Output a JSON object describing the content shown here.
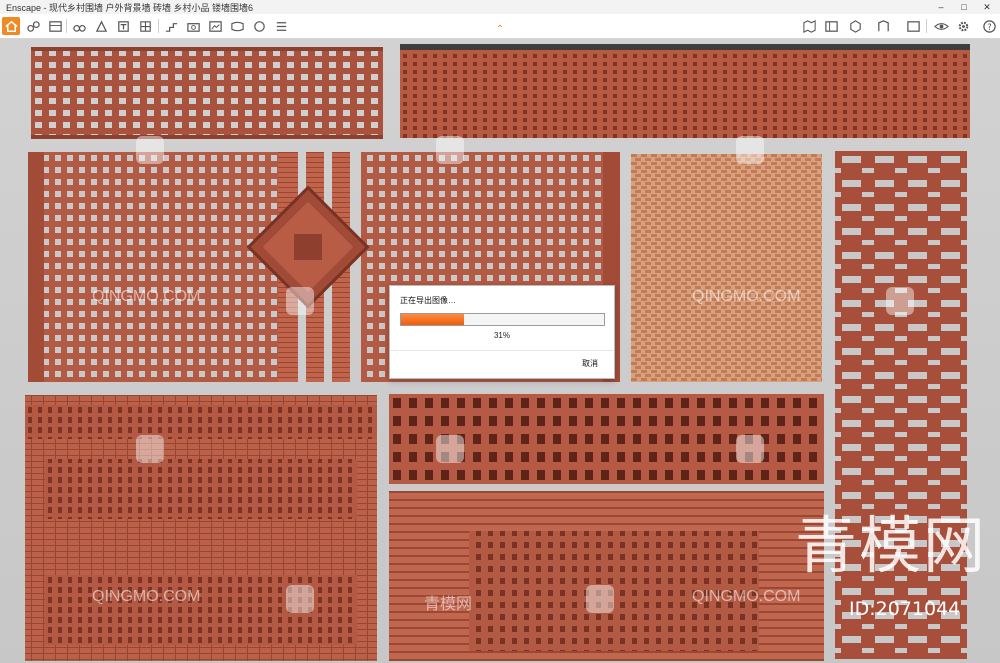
{
  "window": {
    "title": "Enscape - 现代乡村围墙 户外背景墙 砖墙 乡村小品 镂墙围墙6",
    "min_label": "–",
    "max_label": "□",
    "close_label": "✕"
  },
  "toolbar": {
    "left_icons": [
      "home-icon",
      "link-icon",
      "bim-icon",
      "binoculars-icon",
      "object-icon",
      "text-icon",
      "grid-icon",
      "stairs-icon",
      "camera-icon",
      "screenshot-icon",
      "panorama-icon",
      "render-icon",
      "batch-icon",
      "undo-icon",
      "redo-icon"
    ],
    "right_icons": [
      "map-icon",
      "layout-icon",
      "materials-icon",
      "asset-icon",
      "sky-icon",
      "visibility-icon",
      "settings-icon",
      "help-icon"
    ],
    "collapse_glyph": "⌃",
    "accent_color": "#f08a24"
  },
  "export_dialog": {
    "title": "正在导出图像…",
    "progress_percent": 31,
    "progress_label": "31%",
    "cancel_label": "取消"
  },
  "watermarks": {
    "site": "QINGMO.COM",
    "site_cn": "青模网",
    "brand": "青模网",
    "id_label": "ID:2071044"
  },
  "colors": {
    "brick": "#b85c45",
    "brick_dark": "#8f3f2d",
    "brick_light": "#d18a63",
    "viewport_bg": "#c9c9c9"
  }
}
